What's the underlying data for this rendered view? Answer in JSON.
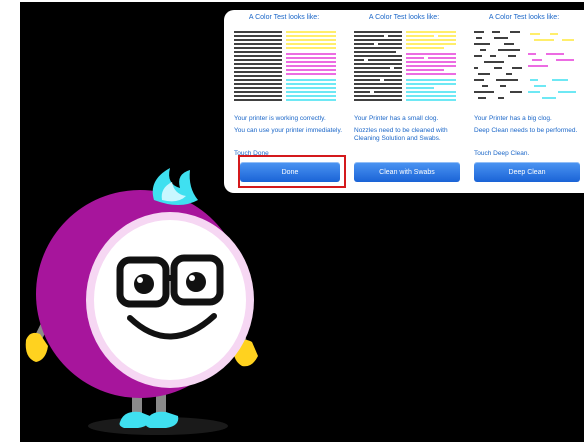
{
  "panel": {
    "columns": [
      {
        "title": "A Color Test looks like:",
        "status": "Your printer is working correctly.",
        "instruction": "You can use your printer immediately.",
        "touch": "Touch Done",
        "button": "Done"
      },
      {
        "title": "A Color Test looks like:",
        "status": "Your Printer has a small clog.",
        "instruction": "Nozzles need to be cleaned with Cleaning Solution and Swabs.",
        "touch": "",
        "button": "Clean with Swabs"
      },
      {
        "title": "A Color Test looks like:",
        "status": "Your Printer has a big clog.",
        "instruction": "Deep Clean needs to be performed.",
        "touch": "Touch Deep Clean.",
        "button": "Deep Clean"
      }
    ]
  },
  "colors": {
    "accent_text": "#1a66c8",
    "button": "#2f78e6",
    "highlight": "#d4191c",
    "mascot_body": "#a7159c",
    "cyan": "#3fe0f0",
    "magenta": "#e63bd8",
    "yellow": "#ffe93a"
  },
  "icons": [
    "mascot-character",
    "test-pattern"
  ]
}
